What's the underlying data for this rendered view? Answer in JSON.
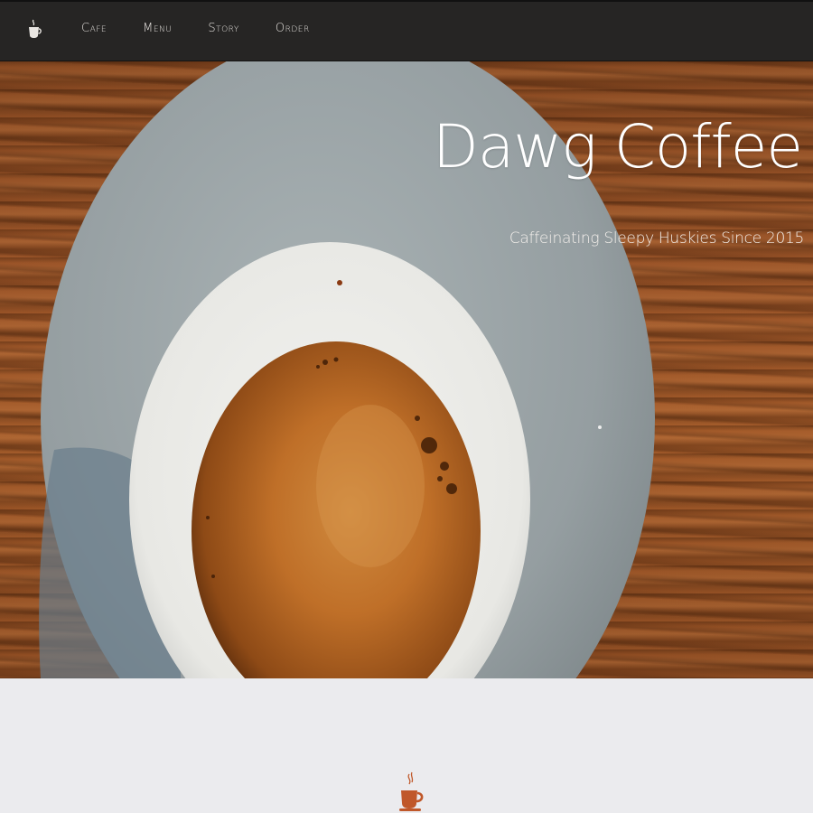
{
  "nav": {
    "logo_icon": "coffee-cup-icon",
    "links": [
      {
        "label": "Cafe"
      },
      {
        "label": "Menu"
      },
      {
        "label": "Story"
      },
      {
        "label": "Order"
      }
    ]
  },
  "hero": {
    "title": "Dawg Coffee",
    "subtitle": "Caffeinating Sleepy Huskies Since 2015"
  },
  "content": {
    "icon": "coffee-cup-icon",
    "icon_color": "#c0582a"
  },
  "colors": {
    "navbar_bg": "#262524",
    "section_bg": "#ebebee",
    "accent": "#c0582a"
  }
}
